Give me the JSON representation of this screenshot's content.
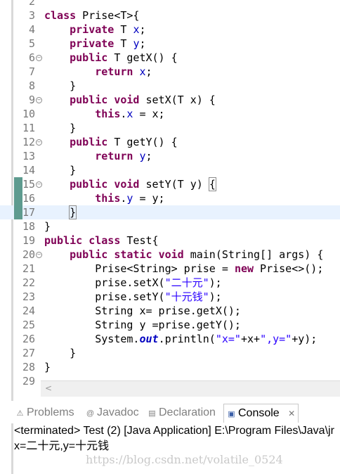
{
  "editor": {
    "lines": [
      {
        "n": "2",
        "html": ""
      },
      {
        "n": "3",
        "html": "<span class=\"kw\">class</span> Prise&lt;T&gt;{"
      },
      {
        "n": "4",
        "html": "    <span class=\"kw\">private</span> T <span class=\"fld\">x</span>;"
      },
      {
        "n": "5",
        "html": "    <span class=\"kw\">private</span> T <span class=\"fld\">y</span>;"
      },
      {
        "n": "6",
        "fold": true,
        "html": "    <span class=\"kw\">public</span> T getX() {"
      },
      {
        "n": "7",
        "html": "        <span class=\"kw\">return</span> <span class=\"fld\">x</span>;"
      },
      {
        "n": "8",
        "html": "    }"
      },
      {
        "n": "9",
        "fold": true,
        "html": "    <span class=\"kw\">public</span> <span class=\"kw\">void</span> setX(T x) {"
      },
      {
        "n": "10",
        "html": "        <span class=\"kw\">this</span>.<span class=\"fld\">x</span> = x;"
      },
      {
        "n": "11",
        "html": "    }"
      },
      {
        "n": "12",
        "fold": true,
        "html": "    <span class=\"kw\">public</span> T getY() {"
      },
      {
        "n": "13",
        "html": "        <span class=\"kw\">return</span> <span class=\"fld\">y</span>;"
      },
      {
        "n": "14",
        "html": "    }"
      },
      {
        "n": "15",
        "fold": true,
        "marker": true,
        "html": "    <span class=\"kw\">public</span> <span class=\"kw\">void</span> setY(T y) <span class=\"brace-box\">{</span>"
      },
      {
        "n": "16",
        "marker": true,
        "html": "        <span class=\"kw\">this</span>.<span class=\"fld\">y</span> = y;"
      },
      {
        "n": "17",
        "marker": true,
        "current": true,
        "html": "    <span class=\"brace-box\">}</span><span class=\"caret\"></span>"
      },
      {
        "n": "18",
        "html": "}"
      },
      {
        "n": "19",
        "html": "<span class=\"kw\">public</span> <span class=\"kw\">class</span> Test{"
      },
      {
        "n": "20",
        "fold": true,
        "html": "    <span class=\"kw\">public</span> <span class=\"kw\">static</span> <span class=\"kw\">void</span> main(String[] args) {"
      },
      {
        "n": "21",
        "html": "        Prise&lt;String&gt; prise = <span class=\"kw\">new</span> Prise&lt;&gt;();"
      },
      {
        "n": "22",
        "html": "        prise.setX(<span class=\"str\">\"二十元\"</span>);"
      },
      {
        "n": "23",
        "html": "        prise.setY(<span class=\"str\">\"十元钱\"</span>);"
      },
      {
        "n": "24",
        "html": "        String x= prise.getX();"
      },
      {
        "n": "25",
        "html": "        String y =prise.getY();"
      },
      {
        "n": "26",
        "html": "        System.<span class=\"stat\">out</span>.println(<span class=\"str\">\"x=\"</span>+x+<span class=\"str\">\",y=\"</span>+y);"
      },
      {
        "n": "27",
        "html": "    }"
      },
      {
        "n": "28",
        "html": "}"
      },
      {
        "n": "29",
        "html": ""
      }
    ]
  },
  "scrollbar": {
    "left_arrow": "<"
  },
  "panel": {
    "tabs": [
      {
        "label": "Problems",
        "icon": "problems-icon",
        "glyph": "⚠"
      },
      {
        "label": "Javadoc",
        "icon": "javadoc-icon",
        "glyph": "@"
      },
      {
        "label": "Declaration",
        "icon": "declaration-icon",
        "glyph": "▤"
      },
      {
        "label": "Console",
        "icon": "console-icon",
        "glyph": "▣",
        "active": true
      }
    ],
    "close_glyph": "✕",
    "console_status": "<terminated> Test (2) [Java Application] E:\\Program Files\\Java\\jr",
    "console_output": "x=二十元,y=十元钱"
  },
  "watermark": "https://blog.csdn.net/volatile_0524"
}
